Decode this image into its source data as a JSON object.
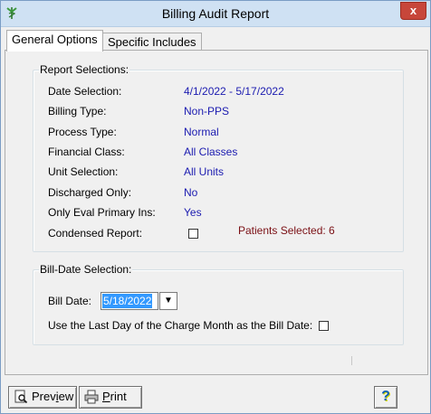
{
  "window": {
    "title": "Billing Audit Report",
    "close_label": "x"
  },
  "tabs": [
    {
      "label": "General Options",
      "active": true
    },
    {
      "label": "Specific Includes",
      "active": false
    }
  ],
  "report_selections": {
    "legend": "Report Selections:",
    "rows": [
      {
        "label": "Date Selection:",
        "value": "4/1/2022 - 5/17/2022"
      },
      {
        "label": "Billing Type:",
        "value": "Non-PPS"
      },
      {
        "label": "Process Type:",
        "value": "Normal"
      },
      {
        "label": "Financial Class:",
        "value": "All Classes"
      },
      {
        "label": "Unit Selection:",
        "value": "All Units"
      },
      {
        "label": "Discharged Only:",
        "value": "No"
      },
      {
        "label": "Only Eval Primary Ins:",
        "value": "Yes"
      }
    ],
    "condensed_label": "Condensed Report:",
    "condensed_checked": false,
    "patients_selected": "Patients Selected: 6"
  },
  "bill_date_selection": {
    "legend": "Bill-Date Selection:",
    "bill_date_label": "Bill Date:",
    "bill_date_value": "5/18/2022",
    "last_day_label": "Use the Last Day of the Charge Month as the Bill Date:",
    "last_day_checked": false
  },
  "buttons": {
    "preview_label": "Preview",
    "print_label": "Print",
    "help_label": "?"
  },
  "colors": {
    "value_text": "#1b1bb0",
    "patients_text": "#7a0f14",
    "selection": "#3399ff"
  },
  "icons": {
    "app": "caduceus-icon",
    "preview": "magnifier-document-icon",
    "print": "printer-icon",
    "help": "question-mark-icon"
  }
}
